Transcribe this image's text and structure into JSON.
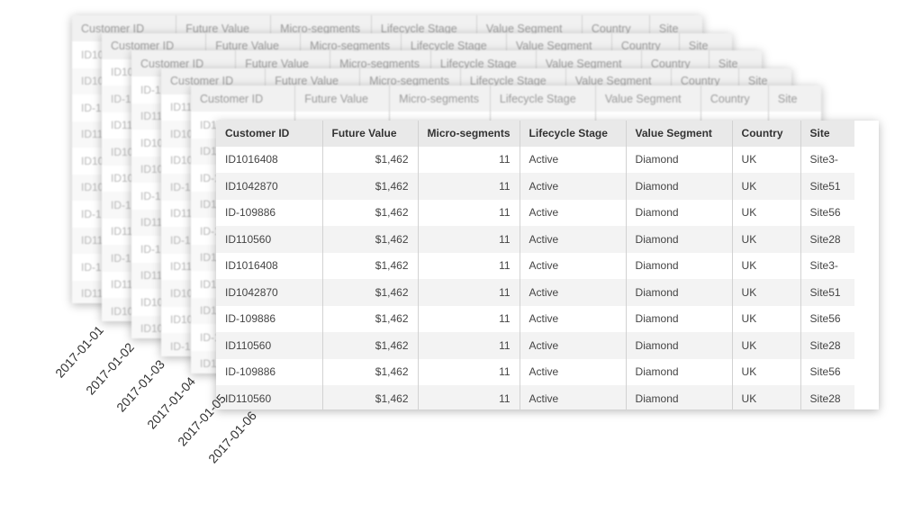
{
  "snapshots": {
    "dates": [
      "2017-01-01",
      "2017-01-02",
      "2017-01-03",
      "2017-01-04",
      "2017-01-05",
      "2017-01-06"
    ]
  },
  "table": {
    "columns": [
      "Customer ID",
      "Future Value",
      "Micro-segments",
      "Lifecycle Stage",
      "Value Segment",
      "Country",
      "Site"
    ],
    "rows": [
      [
        "ID1016408",
        "$1,462",
        "11",
        "Active",
        "Diamond",
        "UK",
        "Site3-"
      ],
      [
        "ID1042870",
        "$1,462",
        "11",
        "Active",
        "Diamond",
        "UK",
        "Site51"
      ],
      [
        "ID-109886",
        "$1,462",
        "11",
        "Active",
        "Diamond",
        "UK",
        "Site56"
      ],
      [
        "ID110560",
        "$1,462",
        "11",
        "Active",
        "Diamond",
        "UK",
        "Site28"
      ],
      [
        "ID1016408",
        "$1,462",
        "11",
        "Active",
        "Diamond",
        "UK",
        "Site3-"
      ],
      [
        "ID1042870",
        "$1,462",
        "11",
        "Active",
        "Diamond",
        "UK",
        "Site51"
      ],
      [
        "ID-109886",
        "$1,462",
        "11",
        "Active",
        "Diamond",
        "UK",
        "Site56"
      ],
      [
        "ID110560",
        "$1,462",
        "11",
        "Active",
        "Diamond",
        "UK",
        "Site28"
      ],
      [
        "ID-109886",
        "$1,462",
        "11",
        "Active",
        "Diamond",
        "UK",
        "Site56"
      ],
      [
        "ID110560",
        "$1,462",
        "11",
        "Active",
        "Diamond",
        "UK",
        "Site28"
      ]
    ]
  },
  "back_layers": {
    "columns": [
      "Customer ID",
      "Future Value",
      "Micro-segments",
      "Lifecycle Stage",
      "Value Segment",
      "Country",
      "Site"
    ],
    "id_stubs": [
      "ID10",
      "ID10",
      "ID-1",
      "ID11",
      "ID10",
      "ID10",
      "ID-1",
      "ID11",
      "ID-1",
      "ID11"
    ]
  }
}
